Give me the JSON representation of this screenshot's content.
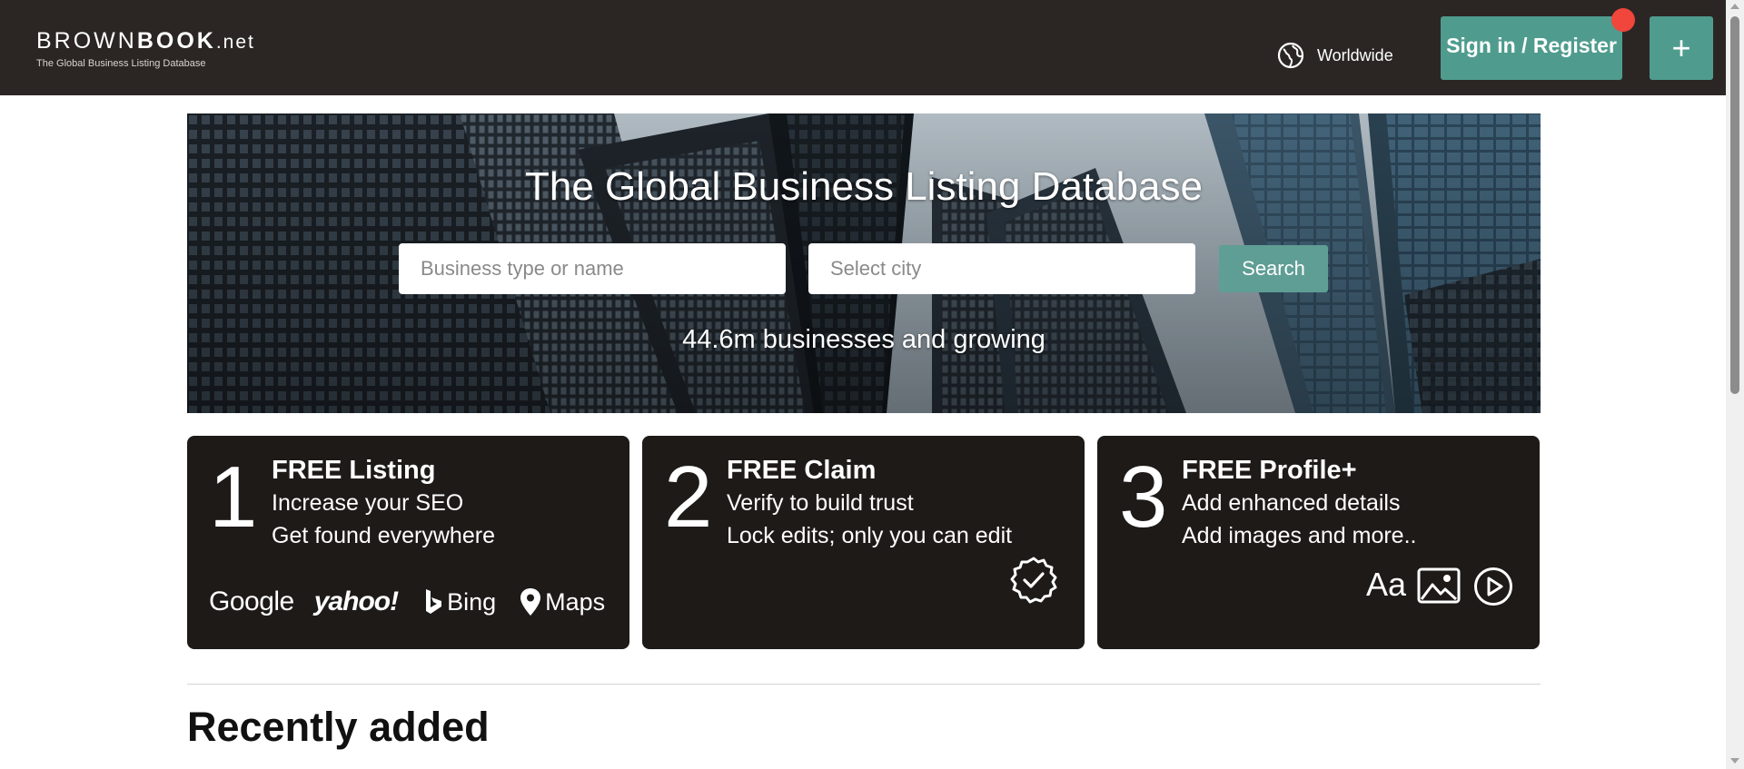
{
  "header": {
    "logo_left": "BROWN",
    "logo_bold": "BOOK",
    "logo_net": ".net",
    "tagline": "The Global Business Listing Database",
    "region_icon": "globe-icon",
    "region": "Worldwide",
    "signin_label": "Sign in / Register",
    "add_label": "+"
  },
  "hero": {
    "title": "The Global Business Listing Database",
    "search_business_placeholder": "Business type or name",
    "search_city_placeholder": "Select city",
    "search_button": "Search",
    "count_text": "44.6m businesses and growing"
  },
  "cards": [
    {
      "number": "1",
      "title": "FREE Listing",
      "line1": "Increase your SEO",
      "line2": "Get found everywhere",
      "engines": [
        "Google",
        "yahoo!",
        "Bing",
        "Maps"
      ]
    },
    {
      "number": "2",
      "title": "FREE Claim",
      "line1": "Verify to build trust",
      "line2": "Lock edits; only you can edit",
      "icon": "verified-badge-icon"
    },
    {
      "number": "3",
      "title": "FREE Profile+",
      "line1": "Add enhanced details",
      "line2": "Add images and more..",
      "icon_text": "Aa",
      "icons": [
        "text-icon",
        "image-icon",
        "play-icon"
      ]
    }
  ],
  "sections": {
    "recent_title": "Recently added"
  },
  "colors": {
    "header_bg": "#2b2624",
    "accent": "#4f9c8e",
    "notification": "#f0463c",
    "card_bg": "#1e1a18"
  }
}
